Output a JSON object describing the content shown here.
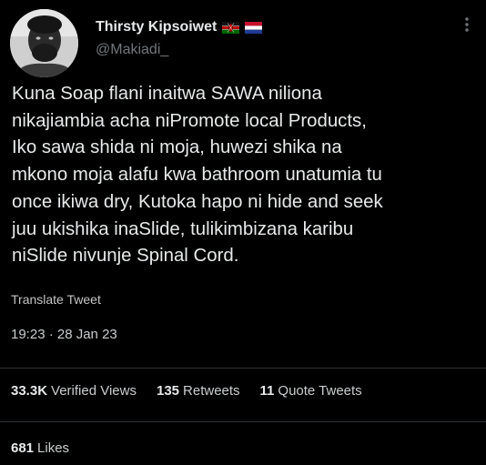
{
  "author": {
    "display_name": "Thirsty Kipsoiwet",
    "handle": "@Makiadi_",
    "flags": [
      "kenya-flag-icon",
      "netherlands-flag-icon"
    ]
  },
  "tweet": {
    "text": "Kuna Soap flani inaitwa SAWA niliona\nnikajiambia acha niPromote local Products,\nIko sawa shida ni moja, huwezi shika na\nmkono moja alafu kwa bathroom unatumia tu\nonce ikiwa dry, Kutoka hapo ni hide and seek\njuu ukishika inaSlide, tulikimbizana karibu\nniSlide nivunje Spinal Cord.",
    "translate_label": "Translate Tweet",
    "timestamp": "19:23 · 28 Jan 23"
  },
  "stats": {
    "views_count": "33.3K",
    "views_label": "Verified Views",
    "retweets_count": "135",
    "retweets_label": "Retweets",
    "quotes_count": "11",
    "quotes_label": "Quote Tweets",
    "likes_count": "681",
    "likes_label": "Likes"
  },
  "colors": {
    "background": "#000000",
    "text_primary": "#e7e9ea",
    "text_secondary": "#71767b",
    "divider": "#2f3336"
  }
}
